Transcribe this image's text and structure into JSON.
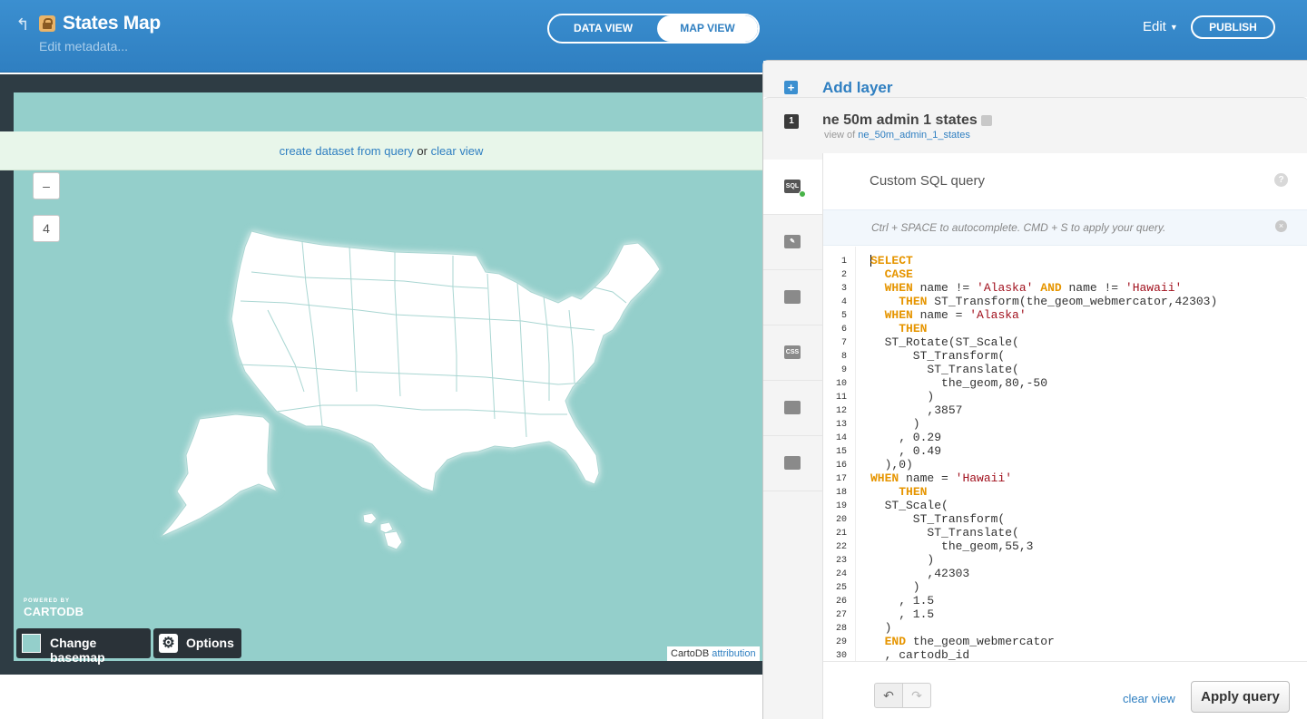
{
  "header": {
    "title": "States Map",
    "metadata_link": "Edit metadata...",
    "view_toggle": {
      "data_view": "DATA VIEW",
      "map_view": "MAP VIEW",
      "active": "MAP VIEW"
    },
    "edit_menu": "Edit",
    "publish": "PUBLISH"
  },
  "map": {
    "zoom_level": "4",
    "zoom_out": "–",
    "notice": {
      "create_link": "create dataset from query",
      "or_text": " or ",
      "clear_link": "clear view"
    },
    "logo": {
      "small": "POWERED BY",
      "big": "CARTODB"
    },
    "change_basemap": "Change basemap",
    "options": "Options",
    "attribution_prefix": "CartoDB ",
    "attribution_link": "attribution",
    "colors": {
      "water": "#94cfcb",
      "land": "#ffffff"
    }
  },
  "panel": {
    "add_layer": "Add layer",
    "layer": {
      "number": "1",
      "name": "ne 50m admin 1 states",
      "view_of_prefix": "view of ",
      "view_of_table": "ne_50m_admin_1_states"
    },
    "tools": [
      {
        "name": "sql",
        "label": "SQL"
      },
      {
        "name": "wizard",
        "label": ""
      },
      {
        "name": "infowindow",
        "label": ""
      },
      {
        "name": "css",
        "label": "CSS"
      },
      {
        "name": "legend",
        "label": ""
      },
      {
        "name": "filters",
        "label": ""
      }
    ],
    "sql": {
      "title": "Custom SQL query",
      "hint": "Ctrl + SPACE to autocomplete. CMD + S to apply your query.",
      "clear_view": "clear view",
      "apply": "Apply query"
    }
  }
}
